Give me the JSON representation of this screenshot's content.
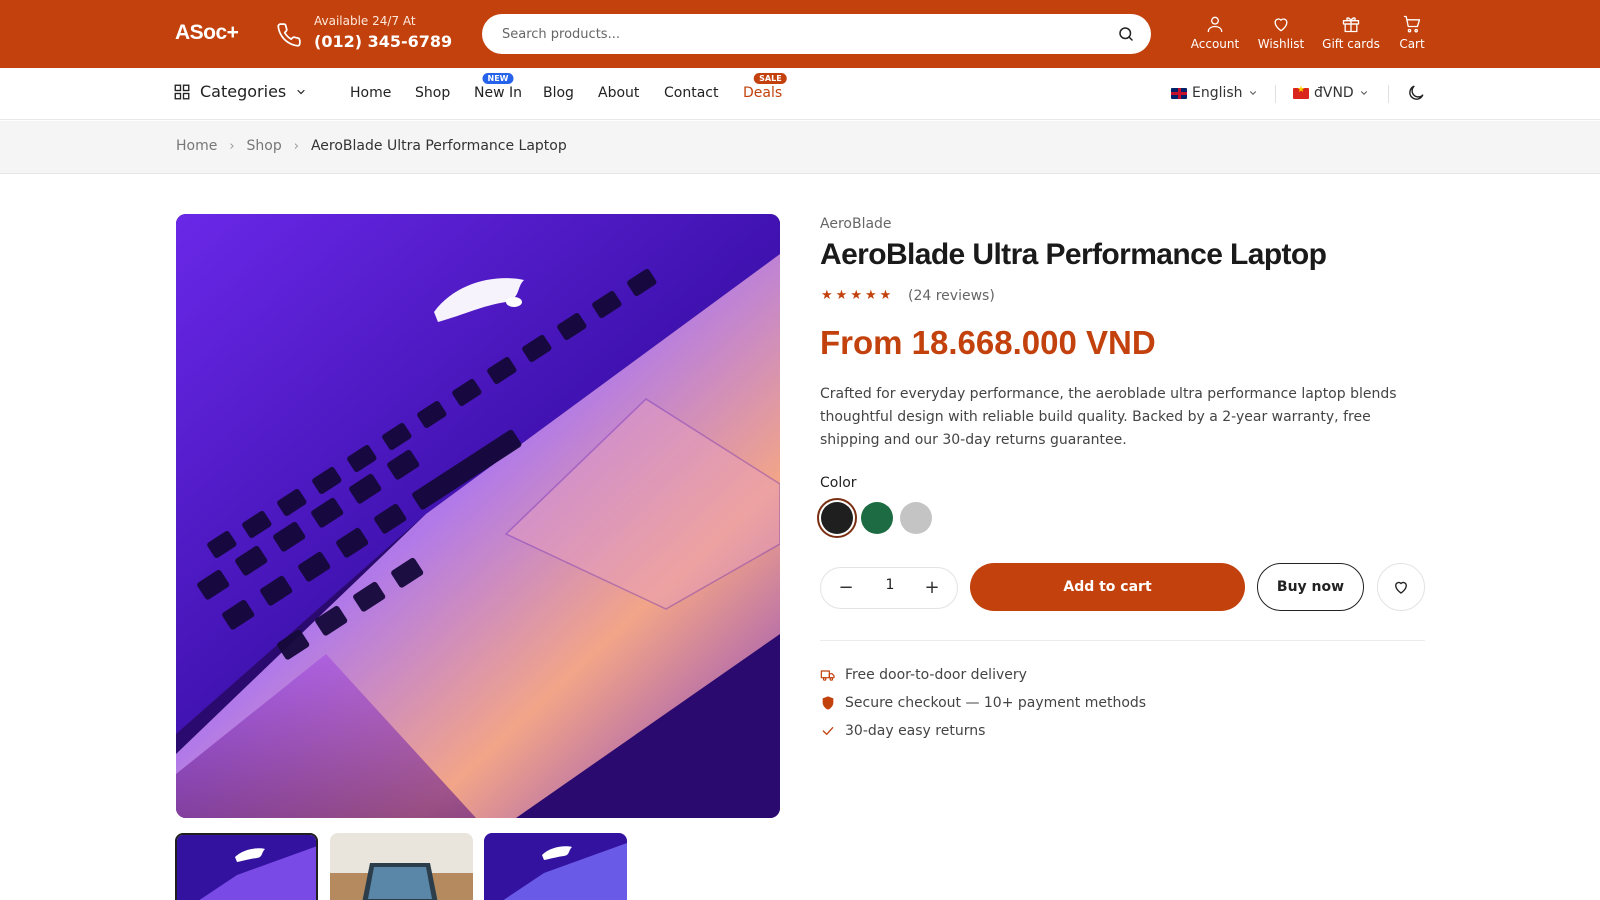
{
  "header": {
    "logo": "ASoc+",
    "phone_caption": "Available 24/7 At",
    "phone_number": "(012) 345-6789",
    "search_placeholder": "Search products...",
    "actions": [
      "Account",
      "Wishlist",
      "Gift cards",
      "Cart"
    ]
  },
  "nav": {
    "categories_label": "Categories",
    "links": [
      "Home",
      "Shop",
      "New In",
      "Blog",
      "About",
      "Contact",
      "Deals"
    ],
    "new_badge": "NEW",
    "sale_badge": "SALE",
    "language": "English",
    "currency": "đVND"
  },
  "breadcrumb": [
    "Home",
    "Shop",
    "AeroBlade Ultra Performance Laptop"
  ],
  "product": {
    "brand": "AeroBlade",
    "title": "AeroBlade Ultra Performance Laptop",
    "rating": 5,
    "reviews": "(24 reviews)",
    "price": "From 18.668.000 VND",
    "description": "Crafted for everyday performance, the aeroblade ultra performance laptop blends thoughtful design with reliable build quality. Backed by a 2-year warranty, free shipping and our 30-day returns guarantee.",
    "color_label": "Color",
    "colors": [
      "#1f1f1f",
      "#1d6b43",
      "#c4c4c4"
    ],
    "selected_color": 0,
    "quantity": "1",
    "add_to_cart": "Add to cart",
    "buy_now": "Buy now",
    "perks": [
      "Free door-to-door delivery",
      "Secure checkout — 10+ payment methods",
      "30-day easy returns"
    ]
  },
  "colors": {
    "brand": "#c2410c",
    "new_badge": "#2563eb"
  }
}
